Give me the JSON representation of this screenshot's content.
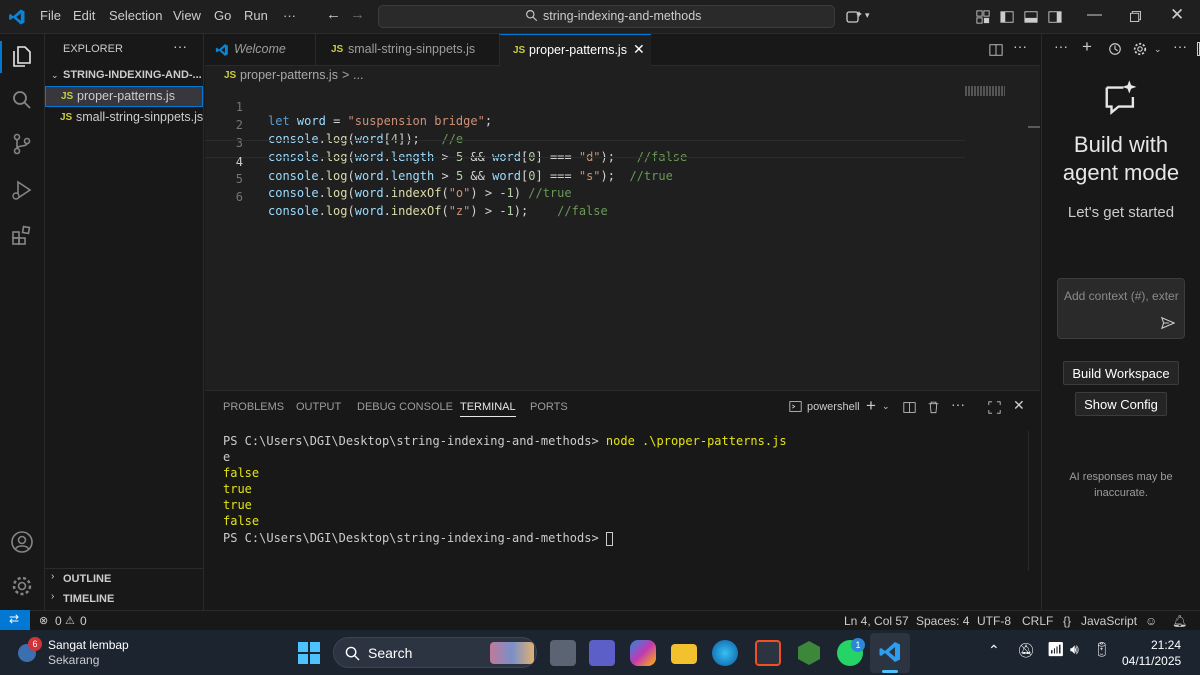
{
  "menu": [
    "File",
    "Edit",
    "Selection",
    "View",
    "Go",
    "Run",
    "···"
  ],
  "search": {
    "text": "string-indexing-and-methods"
  },
  "sidebar": {
    "title": "EXPLORER",
    "folder": "STRING-INDEXING-AND-...",
    "files": [
      {
        "badge": "JS",
        "name": "proper-patterns.js"
      },
      {
        "badge": "JS",
        "name": "small-string-sinppets.js"
      }
    ],
    "outline": "OUTLINE",
    "timeline": "TIMELINE"
  },
  "tabs": [
    {
      "label": "Welcome"
    },
    {
      "badge": "JS",
      "label": "small-string-sinppets.js"
    },
    {
      "badge": "JS",
      "label": "proper-patterns.js"
    }
  ],
  "breadcrumb": {
    "badge": "JS",
    "file": "proper-patterns.js",
    "sep": ">",
    "rest": "..."
  },
  "code_lines": [
    {
      "n": "1",
      "text": "let word = \"suspension bridge\";"
    },
    {
      "n": "2",
      "text": "console.log(word[4]);   //e"
    },
    {
      "n": "3",
      "text": "console.log(word.length > 5 && word[0] === \"d\");   //false"
    },
    {
      "n": "4",
      "text": "console.log(word.length > 5 && word[0] === \"s\");  //true"
    },
    {
      "n": "5",
      "text": "console.log(word.indexOf(\"o\") > -1) //true"
    },
    {
      "n": "6",
      "text": "console.log(word.indexOf(\"z\") > -1);    //false"
    }
  ],
  "panel": {
    "tabs": [
      "PROBLEMS",
      "OUTPUT",
      "DEBUG CONSOLE",
      "TERMINAL",
      "PORTS"
    ],
    "shell": "powershell",
    "terminal": {
      "prompt1": "PS C:\\Users\\DGI\\Desktop\\string-indexing-and-methods>",
      "command": "node .\\proper-patterns.js",
      "output": [
        "e",
        "false",
        "true",
        "true",
        "false"
      ],
      "prompt2": "PS C:\\Users\\DGI\\Desktop\\string-indexing-and-methods>"
    }
  },
  "chat": {
    "heading": "Build with agent mode",
    "sub": "Let's get started",
    "input_placeholder": "Add context (#), exter",
    "btn_workspace": "Build Workspace",
    "btn_config": "Show Config",
    "disclaimer": "AI responses may be inaccurate."
  },
  "status": {
    "errors": "0",
    "warnings": "0",
    "position": "Ln 4, Col 57",
    "spaces": "Spaces: 4",
    "encoding": "UTF-8",
    "eol": "CRLF",
    "language": "JavaScript"
  },
  "taskbar": {
    "weather_count": "6",
    "weather_title": "Sangat lembap",
    "weather_sub": "Sekarang",
    "search": "Search",
    "whatsapp_badge": "1",
    "time": "21:24",
    "date": "04/11/2025"
  },
  "colors": {
    "accent": "#0078d4",
    "background": "#1f1f1f",
    "terminal_output": "#e5e510"
  }
}
